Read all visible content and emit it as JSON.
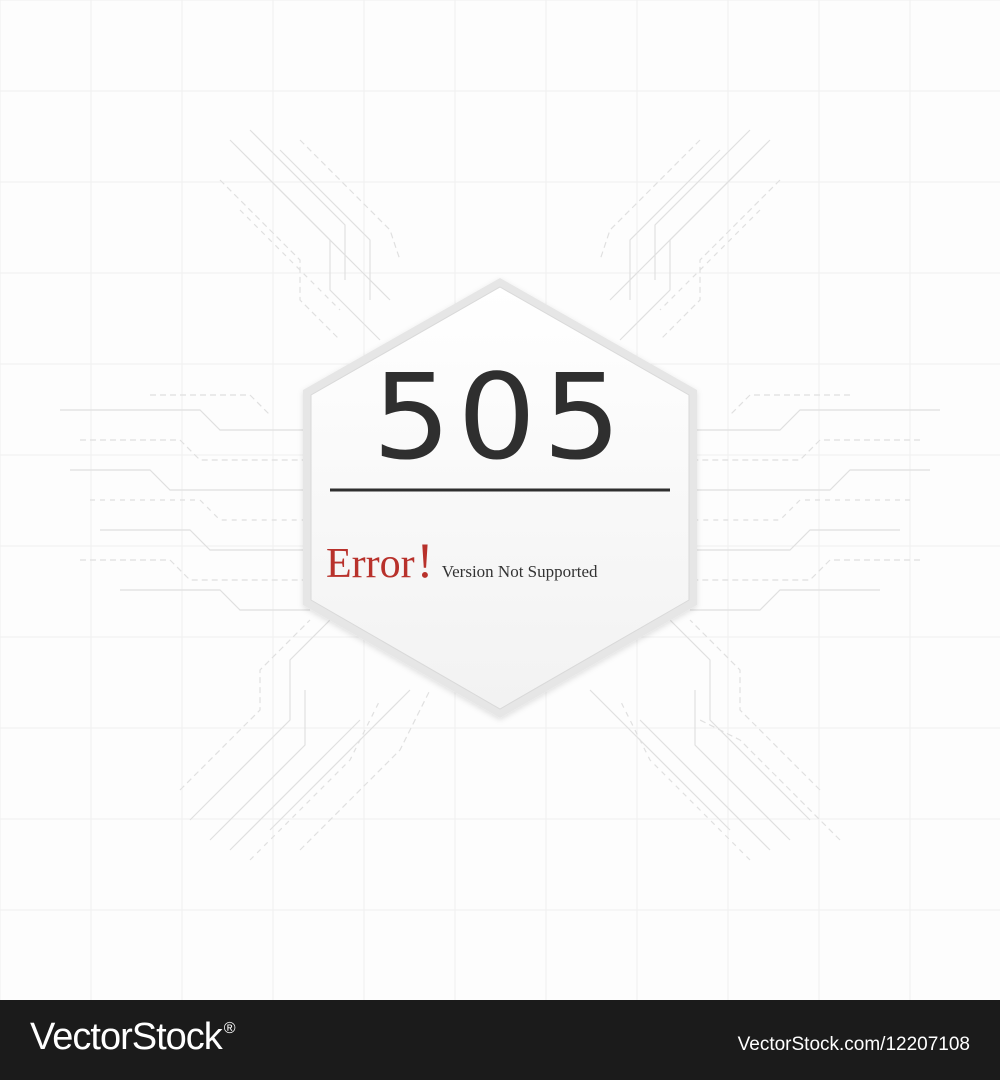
{
  "error": {
    "code": "505",
    "word": "Error",
    "exclamation": "!",
    "message": "Version Not Supported"
  },
  "footer": {
    "brand": "VectorStock",
    "trademark": "®",
    "stock_id": "VectorStock.com/12207108"
  },
  "colors": {
    "code_text": "#2f2f2f",
    "error_red": "#b8312b",
    "footer_bg": "#1b1b1b"
  }
}
